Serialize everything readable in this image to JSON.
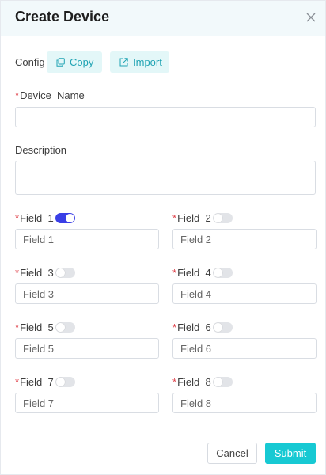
{
  "dialog": {
    "title": "Create Device"
  },
  "config": {
    "label": "Config",
    "copy_label": "Copy",
    "import_label": "Import"
  },
  "device_name": {
    "label": "Device  Name",
    "value": ""
  },
  "description": {
    "label": "Description",
    "value": ""
  },
  "fields": [
    {
      "label": "Field  1",
      "placeholder": "Field 1",
      "enabled": true
    },
    {
      "label": "Field  2",
      "placeholder": "Field 2",
      "enabled": false
    },
    {
      "label": "Field  3",
      "placeholder": "Field 3",
      "enabled": false
    },
    {
      "label": "Field  4",
      "placeholder": "Field 4",
      "enabled": false
    },
    {
      "label": "Field  5",
      "placeholder": "Field 5",
      "enabled": false
    },
    {
      "label": "Field  6",
      "placeholder": "Field 6",
      "enabled": false
    },
    {
      "label": "Field  7",
      "placeholder": "Field 7",
      "enabled": false
    },
    {
      "label": "Field  8",
      "placeholder": "Field 8",
      "enabled": false
    }
  ],
  "footer": {
    "cancel_label": "Cancel",
    "submit_label": "Submit"
  },
  "colors": {
    "accent": "#17c9d3",
    "toggle_on": "#3a3fe6",
    "required": "#e0424b",
    "header_bg": "#f2f9fb"
  },
  "icons": {
    "close": "close-icon",
    "copy": "copy-icon",
    "import": "external-link-icon"
  }
}
